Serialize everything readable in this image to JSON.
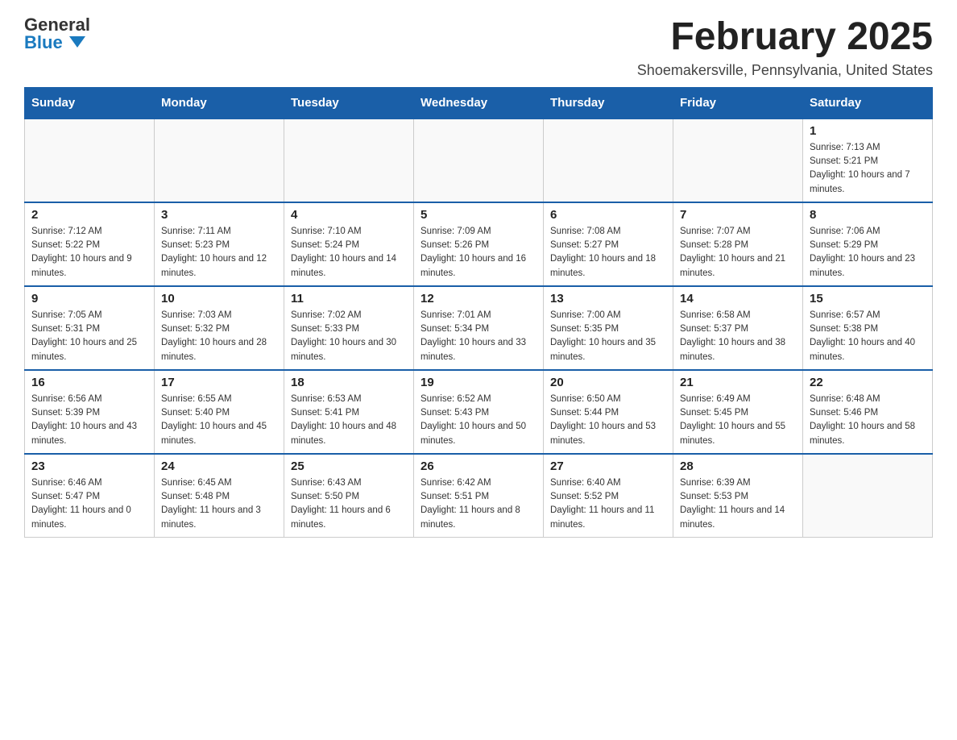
{
  "logo": {
    "general": "General",
    "blue": "Blue"
  },
  "title": "February 2025",
  "location": "Shoemakersville, Pennsylvania, United States",
  "days_of_week": [
    "Sunday",
    "Monday",
    "Tuesday",
    "Wednesday",
    "Thursday",
    "Friday",
    "Saturday"
  ],
  "weeks": [
    [
      {
        "day": "",
        "info": ""
      },
      {
        "day": "",
        "info": ""
      },
      {
        "day": "",
        "info": ""
      },
      {
        "day": "",
        "info": ""
      },
      {
        "day": "",
        "info": ""
      },
      {
        "day": "",
        "info": ""
      },
      {
        "day": "1",
        "info": "Sunrise: 7:13 AM\nSunset: 5:21 PM\nDaylight: 10 hours and 7 minutes."
      }
    ],
    [
      {
        "day": "2",
        "info": "Sunrise: 7:12 AM\nSunset: 5:22 PM\nDaylight: 10 hours and 9 minutes."
      },
      {
        "day": "3",
        "info": "Sunrise: 7:11 AM\nSunset: 5:23 PM\nDaylight: 10 hours and 12 minutes."
      },
      {
        "day": "4",
        "info": "Sunrise: 7:10 AM\nSunset: 5:24 PM\nDaylight: 10 hours and 14 minutes."
      },
      {
        "day": "5",
        "info": "Sunrise: 7:09 AM\nSunset: 5:26 PM\nDaylight: 10 hours and 16 minutes."
      },
      {
        "day": "6",
        "info": "Sunrise: 7:08 AM\nSunset: 5:27 PM\nDaylight: 10 hours and 18 minutes."
      },
      {
        "day": "7",
        "info": "Sunrise: 7:07 AM\nSunset: 5:28 PM\nDaylight: 10 hours and 21 minutes."
      },
      {
        "day": "8",
        "info": "Sunrise: 7:06 AM\nSunset: 5:29 PM\nDaylight: 10 hours and 23 minutes."
      }
    ],
    [
      {
        "day": "9",
        "info": "Sunrise: 7:05 AM\nSunset: 5:31 PM\nDaylight: 10 hours and 25 minutes."
      },
      {
        "day": "10",
        "info": "Sunrise: 7:03 AM\nSunset: 5:32 PM\nDaylight: 10 hours and 28 minutes."
      },
      {
        "day": "11",
        "info": "Sunrise: 7:02 AM\nSunset: 5:33 PM\nDaylight: 10 hours and 30 minutes."
      },
      {
        "day": "12",
        "info": "Sunrise: 7:01 AM\nSunset: 5:34 PM\nDaylight: 10 hours and 33 minutes."
      },
      {
        "day": "13",
        "info": "Sunrise: 7:00 AM\nSunset: 5:35 PM\nDaylight: 10 hours and 35 minutes."
      },
      {
        "day": "14",
        "info": "Sunrise: 6:58 AM\nSunset: 5:37 PM\nDaylight: 10 hours and 38 minutes."
      },
      {
        "day": "15",
        "info": "Sunrise: 6:57 AM\nSunset: 5:38 PM\nDaylight: 10 hours and 40 minutes."
      }
    ],
    [
      {
        "day": "16",
        "info": "Sunrise: 6:56 AM\nSunset: 5:39 PM\nDaylight: 10 hours and 43 minutes."
      },
      {
        "day": "17",
        "info": "Sunrise: 6:55 AM\nSunset: 5:40 PM\nDaylight: 10 hours and 45 minutes."
      },
      {
        "day": "18",
        "info": "Sunrise: 6:53 AM\nSunset: 5:41 PM\nDaylight: 10 hours and 48 minutes."
      },
      {
        "day": "19",
        "info": "Sunrise: 6:52 AM\nSunset: 5:43 PM\nDaylight: 10 hours and 50 minutes."
      },
      {
        "day": "20",
        "info": "Sunrise: 6:50 AM\nSunset: 5:44 PM\nDaylight: 10 hours and 53 minutes."
      },
      {
        "day": "21",
        "info": "Sunrise: 6:49 AM\nSunset: 5:45 PM\nDaylight: 10 hours and 55 minutes."
      },
      {
        "day": "22",
        "info": "Sunrise: 6:48 AM\nSunset: 5:46 PM\nDaylight: 10 hours and 58 minutes."
      }
    ],
    [
      {
        "day": "23",
        "info": "Sunrise: 6:46 AM\nSunset: 5:47 PM\nDaylight: 11 hours and 0 minutes."
      },
      {
        "day": "24",
        "info": "Sunrise: 6:45 AM\nSunset: 5:48 PM\nDaylight: 11 hours and 3 minutes."
      },
      {
        "day": "25",
        "info": "Sunrise: 6:43 AM\nSunset: 5:50 PM\nDaylight: 11 hours and 6 minutes."
      },
      {
        "day": "26",
        "info": "Sunrise: 6:42 AM\nSunset: 5:51 PM\nDaylight: 11 hours and 8 minutes."
      },
      {
        "day": "27",
        "info": "Sunrise: 6:40 AM\nSunset: 5:52 PM\nDaylight: 11 hours and 11 minutes."
      },
      {
        "day": "28",
        "info": "Sunrise: 6:39 AM\nSunset: 5:53 PM\nDaylight: 11 hours and 14 minutes."
      },
      {
        "day": "",
        "info": ""
      }
    ]
  ]
}
